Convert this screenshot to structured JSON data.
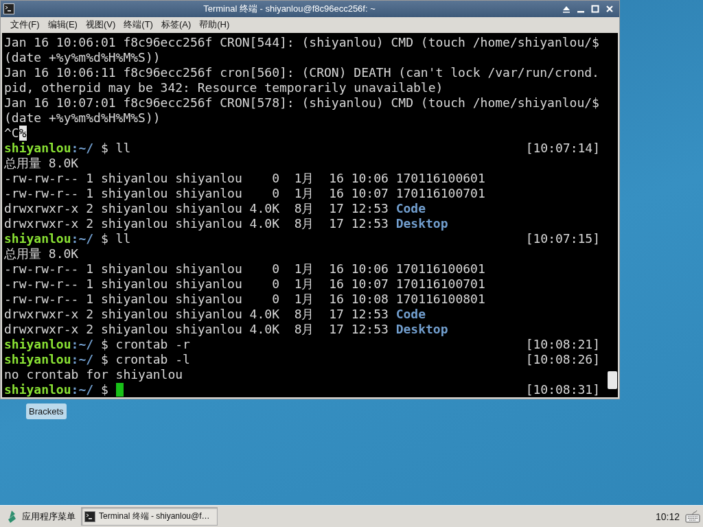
{
  "window": {
    "title": "Terminal 终端 - shiyanlou@f8c96ecc256f: ~"
  },
  "menu": [
    "文件(F)",
    "编辑(E)",
    "视图(V)",
    "终端(T)",
    "标签(A)",
    "帮助(H)"
  ],
  "terminal": {
    "lines": [
      {
        "segments": [
          {
            "kind": "plain",
            "text": "Jan 16 10:06:01 f8c96ecc256f CRON[544]: (shiyanlou) CMD (touch /home/shiyanlou/$"
          }
        ]
      },
      {
        "segments": [
          {
            "kind": "plain",
            "text": "(date +%y%m%d%H%M%S))"
          }
        ]
      },
      {
        "segments": [
          {
            "kind": "plain",
            "text": "Jan 16 10:06:11 f8c96ecc256f cron[560]: (CRON) DEATH (can't lock /var/run/crond."
          }
        ]
      },
      {
        "segments": [
          {
            "kind": "plain",
            "text": "pid, otherpid may be 342: Resource temporarily unavailable)"
          }
        ]
      },
      {
        "segments": [
          {
            "kind": "plain",
            "text": "Jan 16 10:07:01 f8c96ecc256f CRON[578]: (shiyanlou) CMD (touch /home/shiyanlou/$"
          }
        ]
      },
      {
        "segments": [
          {
            "kind": "plain",
            "text": "(date +%y%m%d%H%M%S))"
          }
        ]
      },
      {
        "segments": [
          {
            "kind": "plain",
            "text": "^C"
          },
          {
            "kind": "reverse",
            "text": "%"
          }
        ]
      },
      {
        "segments": [
          {
            "kind": "user",
            "text": "shiyanlou"
          },
          {
            "kind": "path",
            "text": ":~/"
          },
          {
            "kind": "plain",
            "text": " $ ll"
          }
        ],
        "time": "[10:07:14]"
      },
      {
        "segments": [
          {
            "kind": "plain",
            "text": "总用量 8.0K"
          }
        ]
      },
      {
        "segments": [
          {
            "kind": "plain",
            "text": "-rw-rw-r-- 1 shiyanlou shiyanlou    0  1月  16 10:06 170116100601"
          }
        ]
      },
      {
        "segments": [
          {
            "kind": "plain",
            "text": "-rw-rw-r-- 1 shiyanlou shiyanlou    0  1月  16 10:07 170116100701"
          }
        ]
      },
      {
        "segments": [
          {
            "kind": "plain",
            "text": "drwxrwxr-x 2 shiyanlou shiyanlou 4.0K  8月  17 12:53 "
          },
          {
            "kind": "dir",
            "text": "Code"
          }
        ]
      },
      {
        "segments": [
          {
            "kind": "plain",
            "text": "drwxrwxr-x 2 shiyanlou shiyanlou 4.0K  8月  17 12:53 "
          },
          {
            "kind": "dir",
            "text": "Desktop"
          }
        ]
      },
      {
        "segments": [
          {
            "kind": "user",
            "text": "shiyanlou"
          },
          {
            "kind": "path",
            "text": ":~/"
          },
          {
            "kind": "plain",
            "text": " $ ll"
          }
        ],
        "time": "[10:07:15]"
      },
      {
        "segments": [
          {
            "kind": "plain",
            "text": "总用量 8.0K"
          }
        ]
      },
      {
        "segments": [
          {
            "kind": "plain",
            "text": "-rw-rw-r-- 1 shiyanlou shiyanlou    0  1月  16 10:06 170116100601"
          }
        ]
      },
      {
        "segments": [
          {
            "kind": "plain",
            "text": "-rw-rw-r-- 1 shiyanlou shiyanlou    0  1月  16 10:07 170116100701"
          }
        ]
      },
      {
        "segments": [
          {
            "kind": "plain",
            "text": "-rw-rw-r-- 1 shiyanlou shiyanlou    0  1月  16 10:08 170116100801"
          }
        ]
      },
      {
        "segments": [
          {
            "kind": "plain",
            "text": "drwxrwxr-x 2 shiyanlou shiyanlou 4.0K  8月  17 12:53 "
          },
          {
            "kind": "dir",
            "text": "Code"
          }
        ]
      },
      {
        "segments": [
          {
            "kind": "plain",
            "text": "drwxrwxr-x 2 shiyanlou shiyanlou 4.0K  8月  17 12:53 "
          },
          {
            "kind": "dir",
            "text": "Desktop"
          }
        ]
      },
      {
        "segments": [
          {
            "kind": "user",
            "text": "shiyanlou"
          },
          {
            "kind": "path",
            "text": ":~/"
          },
          {
            "kind": "plain",
            "text": " $ crontab -r"
          }
        ],
        "time": "[10:08:21]"
      },
      {
        "segments": [
          {
            "kind": "user",
            "text": "shiyanlou"
          },
          {
            "kind": "path",
            "text": ":~/"
          },
          {
            "kind": "plain",
            "text": " $ crontab -l"
          }
        ],
        "time": "[10:08:26]"
      },
      {
        "segments": [
          {
            "kind": "plain",
            "text": "no crontab for shiyanlou"
          }
        ]
      },
      {
        "segments": [
          {
            "kind": "user",
            "text": "shiyanlou"
          },
          {
            "kind": "path",
            "text": ":~/"
          },
          {
            "kind": "plain",
            "text": " $ "
          }
        ],
        "cursor": true,
        "time": "[10:08:31]"
      }
    ]
  },
  "desktop": {
    "icons": [
      {
        "label": "Brackets"
      }
    ]
  },
  "taskbar": {
    "menu_button": "应用程序菜单",
    "tasks": [
      {
        "label": "Terminal 终端 - shiyanlou@f…",
        "selected": true
      }
    ],
    "clock": "10:12"
  }
}
